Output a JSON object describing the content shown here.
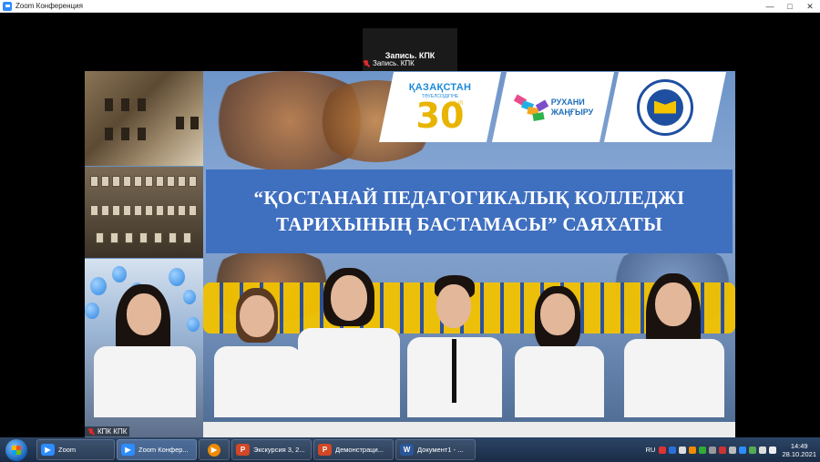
{
  "window": {
    "title": "Zoom Конференция",
    "controls": {
      "minimize": "—",
      "maximize": "□",
      "close": "✕"
    }
  },
  "meeting": {
    "active_speaker": "Запись. КПК",
    "active_speaker_label": "Запись. КПК",
    "share_participant_label": "КПК КПК"
  },
  "slide": {
    "title_line1": "“ҚОСТАНАЙ ПЕДАГОГИКАЛЫҚ КОЛЛЕДЖІ",
    "title_line2": "ТАРИХЫНЫҢ БАСТАМАСЫ” САЯХАТЫ",
    "logo_kz": {
      "title": "ҚАЗАҚСТАН",
      "subtitle": "ТӘУЕЛСІЗДІГІНЕ",
      "number": "30",
      "suffix": "ЖЫЛ"
    },
    "logo_ruhani": {
      "line1": "РУХАНИ",
      "line2": "ЖАҢҒЫРУ"
    }
  },
  "taskbar": {
    "items": [
      {
        "label": "Zoom",
        "icon": "zoom-icon",
        "active": false
      },
      {
        "label": "Zoom Конфер...",
        "icon": "zoom-icon",
        "active": true
      },
      {
        "label": "",
        "icon": "media-player-icon",
        "active": false
      },
      {
        "label": "Экскурсия 3, 2...",
        "icon": "powerpoint-icon",
        "active": false
      },
      {
        "label": "Демонстраци...",
        "icon": "powerpoint-icon",
        "active": false
      },
      {
        "label": "Документ1 - ...",
        "icon": "word-icon",
        "active": false
      }
    ],
    "language": "RU",
    "time": "14:49",
    "date": "28.10.2021"
  },
  "colors": {
    "title_band": "#3f6fbf",
    "taskbar": "#1a2c46",
    "zoom_blue": "#2d8cff",
    "logo_gold": "#e8b400"
  }
}
